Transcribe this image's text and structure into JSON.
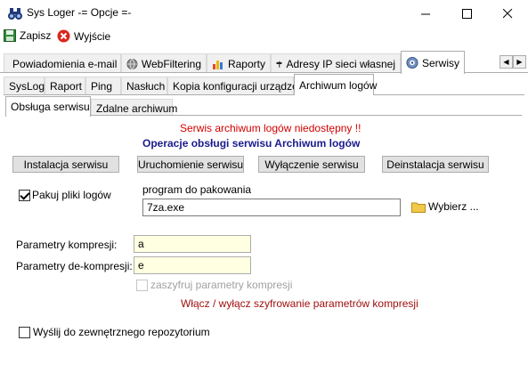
{
  "window": {
    "title": "Sys Loger -= Opcje =-",
    "minimize_glyph": "—",
    "maximize_glyph": "☐",
    "close_glyph": "✕"
  },
  "toolbar": {
    "save_label": "Zapisz",
    "exit_label": "Wyjście"
  },
  "main_tabs": [
    {
      "label": "Powiadomienia e-mail",
      "icon": "keyboard-icon"
    },
    {
      "label": "WebFiltering",
      "icon": "globe-icon"
    },
    {
      "label": "Raporty",
      "icon": "chart-icon"
    },
    {
      "label": "Adresy IP sieci własnej",
      "icon": "signpost-icon"
    },
    {
      "label": "Serwisy",
      "icon": "service-gear-icon"
    }
  ],
  "tab_scroll": {
    "left": "◀",
    "right": "▶"
  },
  "sub_tabs": [
    "SysLog",
    "Raport",
    "Ping",
    "Nasłuch",
    "Kopia konfiguracji urządzeń",
    "Archiwum logów"
  ],
  "third_tabs": [
    "Obsługa serwisu",
    "Zdalne archiwum"
  ],
  "content": {
    "status_message": "Serwis archiwum logów niedostępny !!",
    "section_title": "Operacje obsługi serwisu Archiwum logów",
    "buttons": {
      "install": "Instalacja serwisu",
      "start": "Uruchomienie serwisu",
      "stop": "Wyłączenie serwisu",
      "uninstall": "Deinstalacja serwisu"
    },
    "pack_checkbox_label": "Pakuj pliki logów",
    "packer_label": "program do pakowania",
    "packer_value": "7za.exe",
    "choose_label": "Wybierz ...",
    "compression_params_label": "Parametry kompresji:",
    "compression_params_value": "a",
    "decompression_params_label": "Parametry de-kompresji:",
    "decompression_params_value": "e",
    "encrypt_checkbox_label": "zaszyfruj parametry kompresji",
    "encrypt_toggle_label": "Włącz / wyłącz szyfrowanie parametrów kompresji",
    "send_repo_label": "Wyślij do zewnętrznego repozytorium"
  },
  "colors": {
    "status_red": "#d40000",
    "title_blue": "#1a1a8c",
    "link_red": "#a01010",
    "disabled_gray": "#a0a0a0"
  }
}
